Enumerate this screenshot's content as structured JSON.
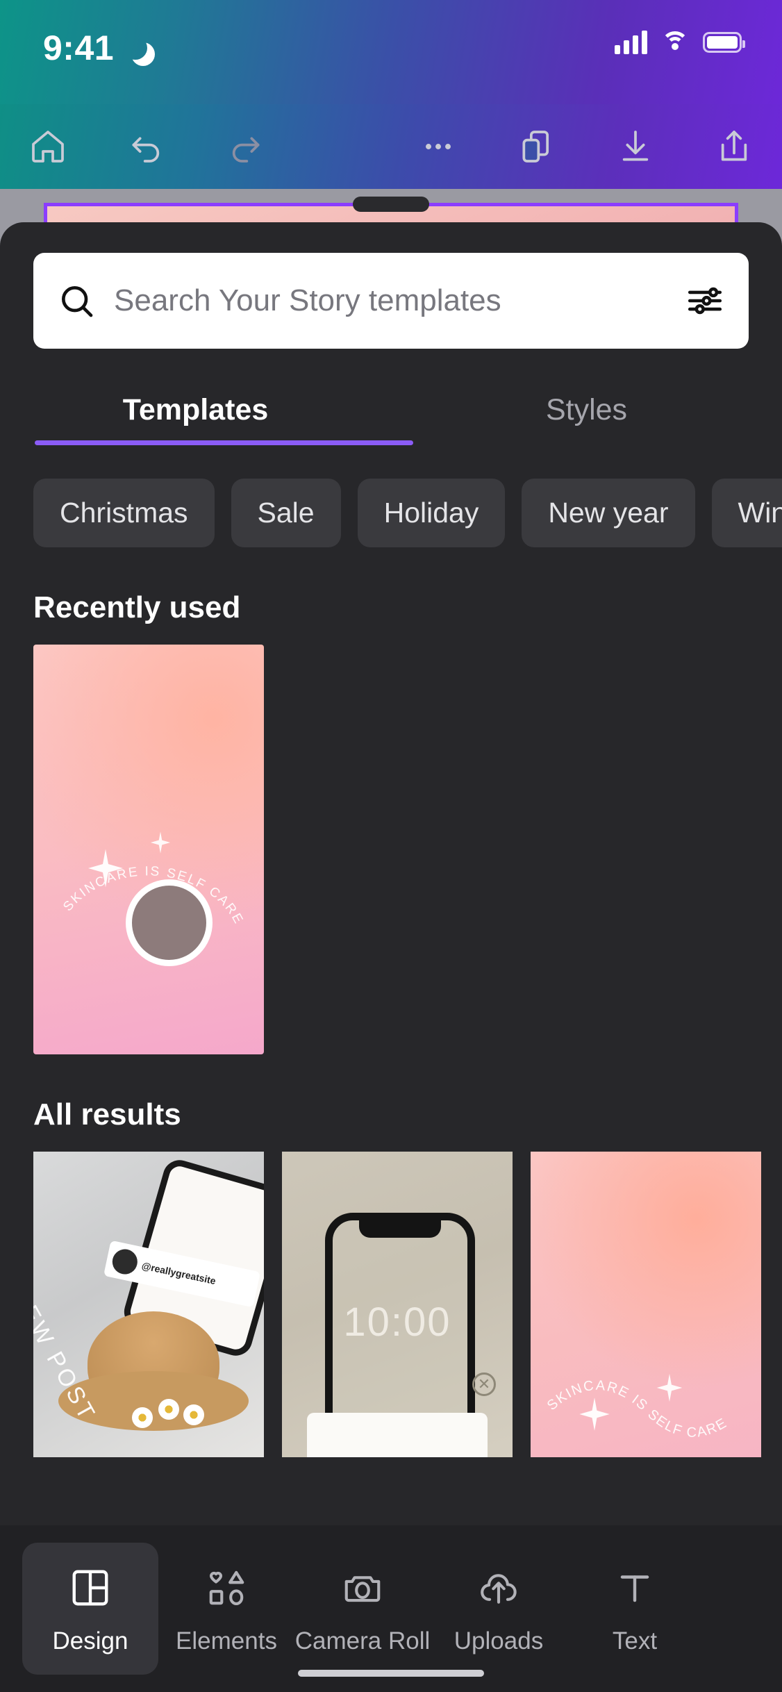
{
  "status_bar": {
    "time": "9:41",
    "moon_icon": "crescent-moon-icon",
    "signal_icon": "cellular-signal-icon",
    "wifi_icon": "wifi-icon",
    "battery_icon": "battery-full-icon"
  },
  "toolbar": {
    "items": [
      {
        "name": "home-icon",
        "label": "Home"
      },
      {
        "name": "undo-icon",
        "label": "Undo"
      },
      {
        "name": "redo-icon",
        "label": "Redo"
      },
      {
        "name": "more-options-icon",
        "label": "More"
      },
      {
        "name": "pages-icon",
        "label": "Pages"
      },
      {
        "name": "download-icon",
        "label": "Download"
      },
      {
        "name": "share-icon",
        "label": "Share"
      }
    ]
  },
  "search": {
    "placeholder": "Search Your Story templates",
    "value": "",
    "search_icon": "search-icon",
    "filter_icon": "filter-sliders-icon"
  },
  "tabs": [
    {
      "label": "Templates",
      "active": true
    },
    {
      "label": "Styles",
      "active": false
    }
  ],
  "chips": [
    {
      "label": "Christmas"
    },
    {
      "label": "Sale"
    },
    {
      "label": "Holiday"
    },
    {
      "label": "New year"
    },
    {
      "label": "Winter"
    }
  ],
  "sections": {
    "recently_used": {
      "title": "Recently used",
      "items": [
        {
          "name": "skincare-template",
          "caption": "SKINCARE IS SELF CARE"
        }
      ]
    },
    "all_results": {
      "title": "All results",
      "items": [
        {
          "name": "new-post-template",
          "label": "NEW POST",
          "handle": "@reallygreatsite"
        },
        {
          "name": "phone-mockup-template",
          "label": "10:00"
        },
        {
          "name": "skincare-gradient-template",
          "caption": "SKINCARE IS SELF CARE"
        }
      ]
    }
  },
  "bottom_nav": [
    {
      "label": "Design",
      "icon": "layout-design-icon",
      "active": true
    },
    {
      "label": "Elements",
      "icon": "shapes-elements-icon",
      "active": false
    },
    {
      "label": "Camera Roll",
      "icon": "camera-icon",
      "active": false
    },
    {
      "label": "Uploads",
      "icon": "cloud-upload-icon",
      "active": false
    },
    {
      "label": "Text",
      "icon": "text-icon",
      "active": false
    }
  ],
  "colors": {
    "accent": "#8b5cf6",
    "sheet_bg": "#27272a",
    "nav_bg": "#212124",
    "chip_bg": "#3a3a3e"
  }
}
